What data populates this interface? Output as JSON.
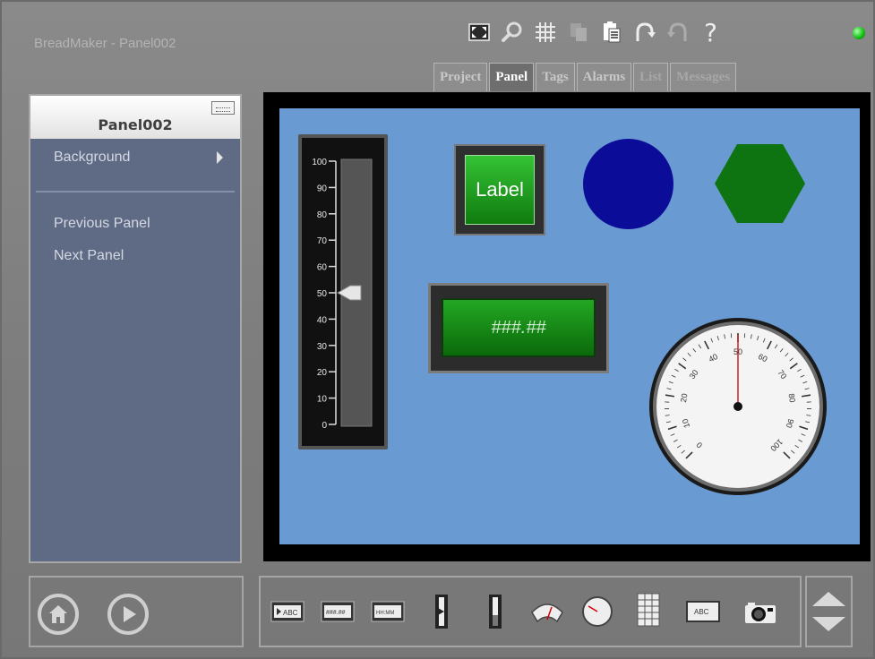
{
  "window": {
    "title": "BreadMaker - Panel002"
  },
  "toolbar": {
    "buttons": [
      {
        "name": "fit-screen",
        "icon": "fit-screen-icon"
      },
      {
        "name": "zoom",
        "icon": "magnifier-icon"
      },
      {
        "name": "grid",
        "icon": "grid-icon"
      },
      {
        "name": "copy",
        "icon": "copy-icon",
        "disabled": true
      },
      {
        "name": "paste",
        "icon": "paste-icon"
      },
      {
        "name": "undo",
        "icon": "undo-icon"
      },
      {
        "name": "redo",
        "icon": "redo-icon",
        "disabled": true
      },
      {
        "name": "help",
        "icon": "help-icon",
        "label": "?"
      }
    ],
    "status_color": "#17c317"
  },
  "tabs": [
    {
      "label": "Project",
      "state": "normal"
    },
    {
      "label": "Panel",
      "state": "active"
    },
    {
      "label": "Tags",
      "state": "normal"
    },
    {
      "label": "Alarms",
      "state": "normal"
    },
    {
      "label": "List",
      "state": "disabled"
    },
    {
      "label": "Messages",
      "state": "disabled"
    }
  ],
  "left_panel": {
    "panel_name": "Panel002",
    "menu": {
      "background": "Background",
      "previous": "Previous Panel",
      "next": "Next Panel"
    }
  },
  "canvas": {
    "background_color": "#6a9ad2",
    "slider": {
      "ticks": [
        "100",
        "90",
        "80",
        "70",
        "60",
        "50",
        "40",
        "30",
        "20",
        "10",
        "0"
      ],
      "value": 50
    },
    "label_button": {
      "text": "Label",
      "color": "#1f9e1f"
    },
    "circle": {
      "color": "#0b0d99"
    },
    "hexagon": {
      "color": "#0e7412"
    },
    "numeric_display": {
      "text": "###.##"
    },
    "gauge": {
      "ticks": [
        "0",
        "10",
        "20",
        "30",
        "40",
        "50",
        "60",
        "70",
        "80",
        "90",
        "100"
      ],
      "value": 50
    }
  },
  "nav": {
    "home": {
      "icon": "home-icon"
    },
    "play": {
      "icon": "play-icon"
    }
  },
  "palette": {
    "items": [
      {
        "name": "label-button",
        "icon": "label-button-widget-icon",
        "text": "ABC"
      },
      {
        "name": "numeric-display",
        "icon": "numeric-display-widget-icon",
        "text": "###.##"
      },
      {
        "name": "time-display",
        "icon": "time-display-widget-icon",
        "text": "HH:MM"
      },
      {
        "name": "vertical-slider",
        "icon": "slider-widget-icon"
      },
      {
        "name": "bar-meter",
        "icon": "bar-meter-widget-icon"
      },
      {
        "name": "arc-meter",
        "icon": "arc-meter-widget-icon"
      },
      {
        "name": "round-gauge",
        "icon": "gauge-widget-icon"
      },
      {
        "name": "table",
        "icon": "table-widget-icon"
      },
      {
        "name": "text-label",
        "icon": "text-widget-icon",
        "text": "ABC"
      },
      {
        "name": "camera",
        "icon": "camera-widget-icon"
      }
    ]
  }
}
